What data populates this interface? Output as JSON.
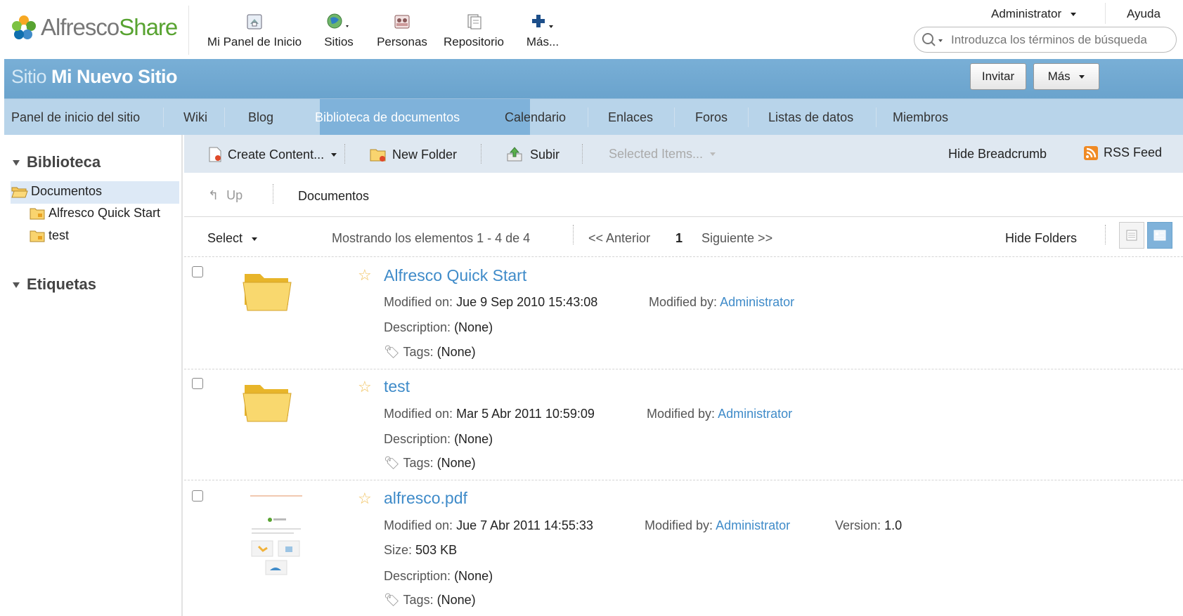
{
  "header": {
    "logo_text_a": "Alfresco",
    "logo_text_b": "Share",
    "nav": [
      {
        "label": "Mi Panel de Inicio",
        "icon": "dashboard-icon"
      },
      {
        "label": "Sitios",
        "icon": "sites-globe-icon"
      },
      {
        "label": "Personas",
        "icon": "people-icon"
      },
      {
        "label": "Repositorio",
        "icon": "repository-icon"
      },
      {
        "label": "Más...",
        "icon": "plus-icon"
      }
    ],
    "user": "Administrator",
    "help": "Ayuda",
    "search_placeholder": "Introduzca los términos de búsqueda"
  },
  "site": {
    "prefix": "Sitio",
    "name": "Mi Nuevo Sitio",
    "invite": "Invitar",
    "more": "Más"
  },
  "site_nav": [
    "Panel de inicio del sitio",
    "Wiki",
    "Blog",
    "Biblioteca de documentos",
    "Calendario",
    "Enlaces",
    "Foros",
    "Listas de datos",
    "Miembros"
  ],
  "left": {
    "library_title": "Biblioteca",
    "root": "Documentos",
    "children": [
      "Alfresco Quick Start",
      "test"
    ],
    "tags_title": "Etiquetas"
  },
  "toolbar": {
    "create": "Create Content...",
    "new_folder": "New Folder",
    "upload": "Subir",
    "selected": "Selected Items...",
    "hide_breadcrumb": "Hide Breadcrumb",
    "rss": "RSS Feed"
  },
  "breadcrumb": {
    "up": "Up",
    "current": "Documentos"
  },
  "list": {
    "select": "Select",
    "showing": "Mostrando los elementos 1 - 4 de 4",
    "prev": "<< Anterior",
    "page": "1",
    "next": "Siguiente >>",
    "hide_folders": "Hide Folders"
  },
  "items": [
    {
      "name": "Alfresco Quick Start",
      "modified_on_label": "Modified on:",
      "modified_on": "Jue 9 Sep 2010 15:43:08",
      "modified_by_label": "Modified by:",
      "modified_by": "Administrator",
      "description_label": "Description:",
      "description": "(None)",
      "tags_label": "Tags:",
      "tags": "(None)"
    },
    {
      "name": "test",
      "modified_on_label": "Modified on:",
      "modified_on": "Mar 5 Abr 2011 10:59:09",
      "modified_by_label": "Modified by:",
      "modified_by": "Administrator",
      "description_label": "Description:",
      "description": "(None)",
      "tags_label": "Tags:",
      "tags": "(None)"
    },
    {
      "name": "alfresco.pdf",
      "modified_on_label": "Modified on:",
      "modified_on": "Jue 7 Abr 2011 14:55:33",
      "modified_by_label": "Modified by:",
      "modified_by": "Administrator",
      "version_label": "Version:",
      "version": "1.0",
      "size_label": "Size:",
      "size": "503 KB",
      "description_label": "Description:",
      "description": "(None)",
      "tags_label": "Tags:",
      "tags": "(None)"
    }
  ],
  "colors": {
    "site_bar": "#6aa3cd",
    "site_nav": "#b8d4ea",
    "link": "#3f8bc9",
    "logo_green": "#58a331"
  }
}
